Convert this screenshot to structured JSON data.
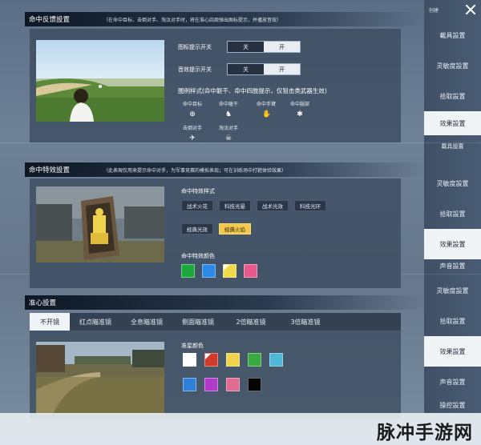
{
  "nav": {
    "top_label": "创建",
    "items_a": [
      "載具設置",
      "灵敏度設置",
      "拾取設置",
      "效果設置"
    ],
    "items_b": [
      "載具設置",
      "灵敏度設置",
      "拾取設置",
      "效果設置",
      "声音設置"
    ],
    "items_c": [
      "灵敏度設置",
      "拾取設置",
      "效果設置",
      "声音設置",
      "操控設置"
    ]
  },
  "feedback": {
    "title": "命中反馈設置",
    "note": "（在命中目标、击倒对手、淘汰对手时，将在准心四周弹出图标提示，并播放音效）",
    "icon_toggle_label": "图标提示开关",
    "sound_toggle_label": "音效提示开关",
    "off": "关",
    "on": "开",
    "legend_title": "图例样式(命中躯干、命中四肢提示，仅狙击类武器生效)",
    "icons": [
      {
        "label": "命中目标",
        "glyph": "⊕",
        "icon": "crosshair-icon"
      },
      {
        "label": "命中躯干",
        "glyph": "♞",
        "icon": "torso-icon"
      },
      {
        "label": "命中手臂",
        "glyph": "✋",
        "icon": "arm-icon"
      },
      {
        "label": "命中腿部",
        "glyph": "✱",
        "icon": "leg-icon"
      }
    ],
    "icons2": [
      {
        "label": "击倒对手",
        "glyph": "✈",
        "icon": "knockdown-icon"
      },
      {
        "label": "淘汰对手",
        "glyph": "☠",
        "icon": "eliminate-icon"
      }
    ]
  },
  "effects": {
    "title": "命中特效設置",
    "note": "（此表現仅用来提示命中对手，为军事竞赛的模拟表现；可在训练场中打靶体验效果）",
    "style_label": "命中特效样式",
    "styles": [
      "战术火花",
      "科技光晕",
      "战术光效",
      "科技光环",
      "经典光效",
      "经典火焰"
    ],
    "selected_style": "经典火焰",
    "color_label": "命中特效颜色",
    "colors": [
      "#1aa83a",
      "#2c8ae6",
      "#f0d94c",
      "#e85a8e"
    ],
    "selected_color_index": 2
  },
  "crosshair": {
    "title": "准心設置",
    "tabs": [
      "不开镜",
      "红点瞄准镜",
      "全息瞄准镜",
      "侧面瞄准镜",
      "2倍瞄准镜",
      "3倍瞄准镜"
    ],
    "active_tab": "不开镜",
    "color_label": "准星颜色",
    "colors": [
      "#ffffff",
      "#d33a2c",
      "#efd34a",
      "#3aaa40",
      "#4fb7d8",
      "#2f80d8",
      "#b23ac9",
      "#e06a92",
      "#050505"
    ],
    "selected_color_index": 1
  },
  "watermark": {
    "text": "脉冲手游网"
  }
}
